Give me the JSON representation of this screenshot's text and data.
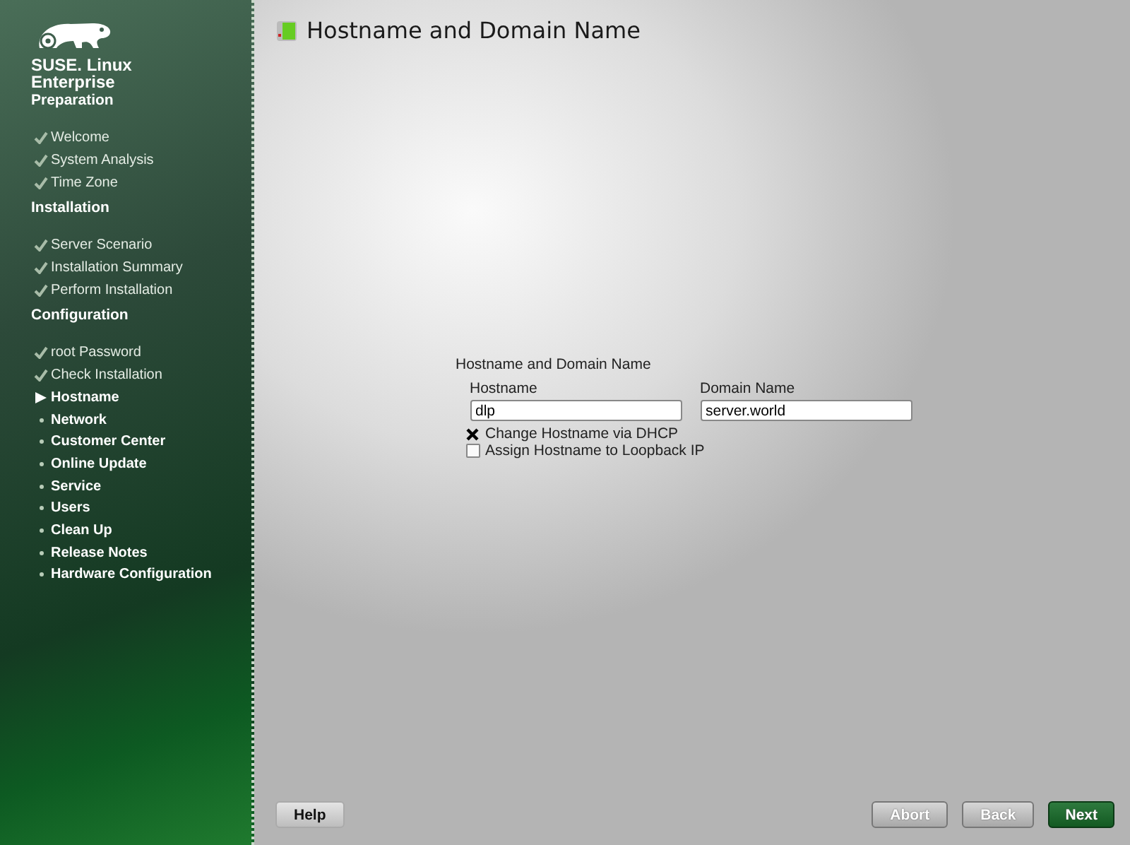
{
  "sidebar": {
    "brand": "SUSE. Linux Enterprise",
    "sections": [
      {
        "title": "Preparation",
        "steps": [
          {
            "label": "Welcome",
            "kind": "done"
          },
          {
            "label": "System Analysis",
            "kind": "done"
          },
          {
            "label": "Time Zone",
            "kind": "done"
          }
        ]
      },
      {
        "title": "Installation",
        "steps": [
          {
            "label": "Server Scenario",
            "kind": "done"
          },
          {
            "label": "Installation Summary",
            "kind": "done"
          },
          {
            "label": "Perform Installation",
            "kind": "done"
          }
        ]
      },
      {
        "title": "Configuration",
        "steps": [
          {
            "label": "root Password",
            "kind": "done"
          },
          {
            "label": "Check Installation",
            "kind": "done"
          },
          {
            "label": "Hostname",
            "kind": "current"
          },
          {
            "label": "Network",
            "kind": "pending"
          },
          {
            "label": "Customer Center",
            "kind": "pending"
          },
          {
            "label": "Online Update",
            "kind": "pending"
          },
          {
            "label": "Service",
            "kind": "pending"
          },
          {
            "label": "Users",
            "kind": "pending"
          },
          {
            "label": "Clean Up",
            "kind": "pending"
          },
          {
            "label": "Release Notes",
            "kind": "pending"
          },
          {
            "label": "Hardware Configuration",
            "kind": "pending"
          }
        ]
      }
    ]
  },
  "page": {
    "title": "Hostname and Domain Name",
    "group": {
      "title": "Hostname and Domain Name",
      "fields": [
        {
          "label": "Hostname",
          "value": "dlp"
        },
        {
          "label": "Domain Name",
          "value": "server.world"
        }
      ],
      "options": [
        {
          "label": "Change Hostname via DHCP",
          "checked": true
        },
        {
          "label": "Assign Hostname to Loopback IP",
          "checked": false
        }
      ]
    }
  },
  "buttons": {
    "left": [
      {
        "label": "Help",
        "primary": false
      }
    ],
    "right": [
      {
        "label": "Abort",
        "primary": false
      },
      {
        "label": "Back",
        "primary": false
      },
      {
        "label": "Next",
        "primary": true
      }
    ]
  }
}
